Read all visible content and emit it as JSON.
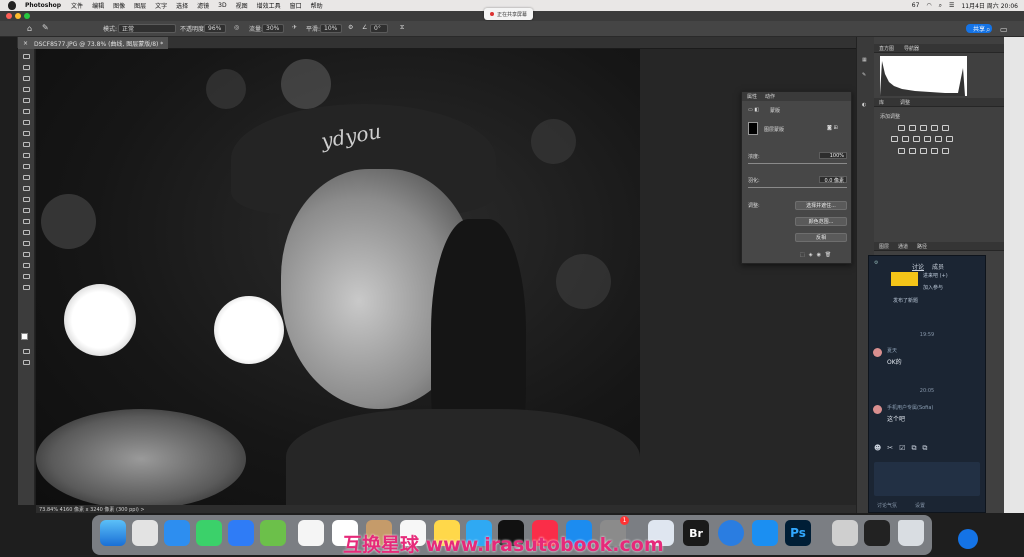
{
  "menubar": {
    "app": "Photoshop",
    "items": [
      "文件",
      "编辑",
      "图像",
      "图层",
      "文字",
      "选择",
      "滤镜",
      "3D",
      "视图",
      "增效工具",
      "窗口",
      "帮助"
    ],
    "status": "67",
    "datetime": "11月4日 周六 20:06"
  },
  "recording": {
    "label": "正在共享屏幕"
  },
  "options": {
    "mode_label": "模式:",
    "mode_value": "正常",
    "opacity_label": "不透明度:",
    "opacity_value": "96%",
    "flow_label": "流量:",
    "flow_value": "30%",
    "smooth_label": "平滑:",
    "smooth_value": "10%",
    "angle_value": "0°",
    "share_label": "共享"
  },
  "document": {
    "tab_title": "DSCF8577.JPG @ 73.8% (曲线, 图层蒙版/8) *"
  },
  "status_bar": {
    "text": "73.84%   4160 像素 x 3240 像素 (300 ppi)   >"
  },
  "properties": {
    "tab1": "属性",
    "tab2": "动作",
    "type": "蒙版",
    "mask_label": "图层蒙版",
    "density_label": "浓度:",
    "density_value": "100%",
    "feather_label": "羽化:",
    "feather_value": "0.0 像素",
    "refine_label": "调整:",
    "btn_select_mask": "选择并遮住...",
    "btn_color_range": "颜色范围...",
    "btn_invert": "反相"
  },
  "right_panels": {
    "hist_tab1": "直方图",
    "hist_tab2": "导航器",
    "adj_tab1": "库",
    "adj_tab2": "调整",
    "adj_add": "添加调整",
    "layers_tab1": "图层",
    "layers_tab2": "通道",
    "layers_tab3": "路径"
  },
  "chat": {
    "tab_discuss": "讨论",
    "tab_members": "成员",
    "msg_top1": "进来吧 (+)",
    "msg_top2": "加入参与",
    "msg_top3": "发布了新题",
    "time1": "19:59",
    "user1": "夏天",
    "msg1": "OK的",
    "time2": "20:05",
    "user2": "手机用户专属(Sofia)",
    "msg2": "这个吧",
    "bottom1": "讨论气氛",
    "bottom2": "设置"
  },
  "watermark": "互换星球 www.irasutobook.com",
  "dock": {
    "ps": "Ps",
    "br": "Br",
    "badge": "1"
  }
}
